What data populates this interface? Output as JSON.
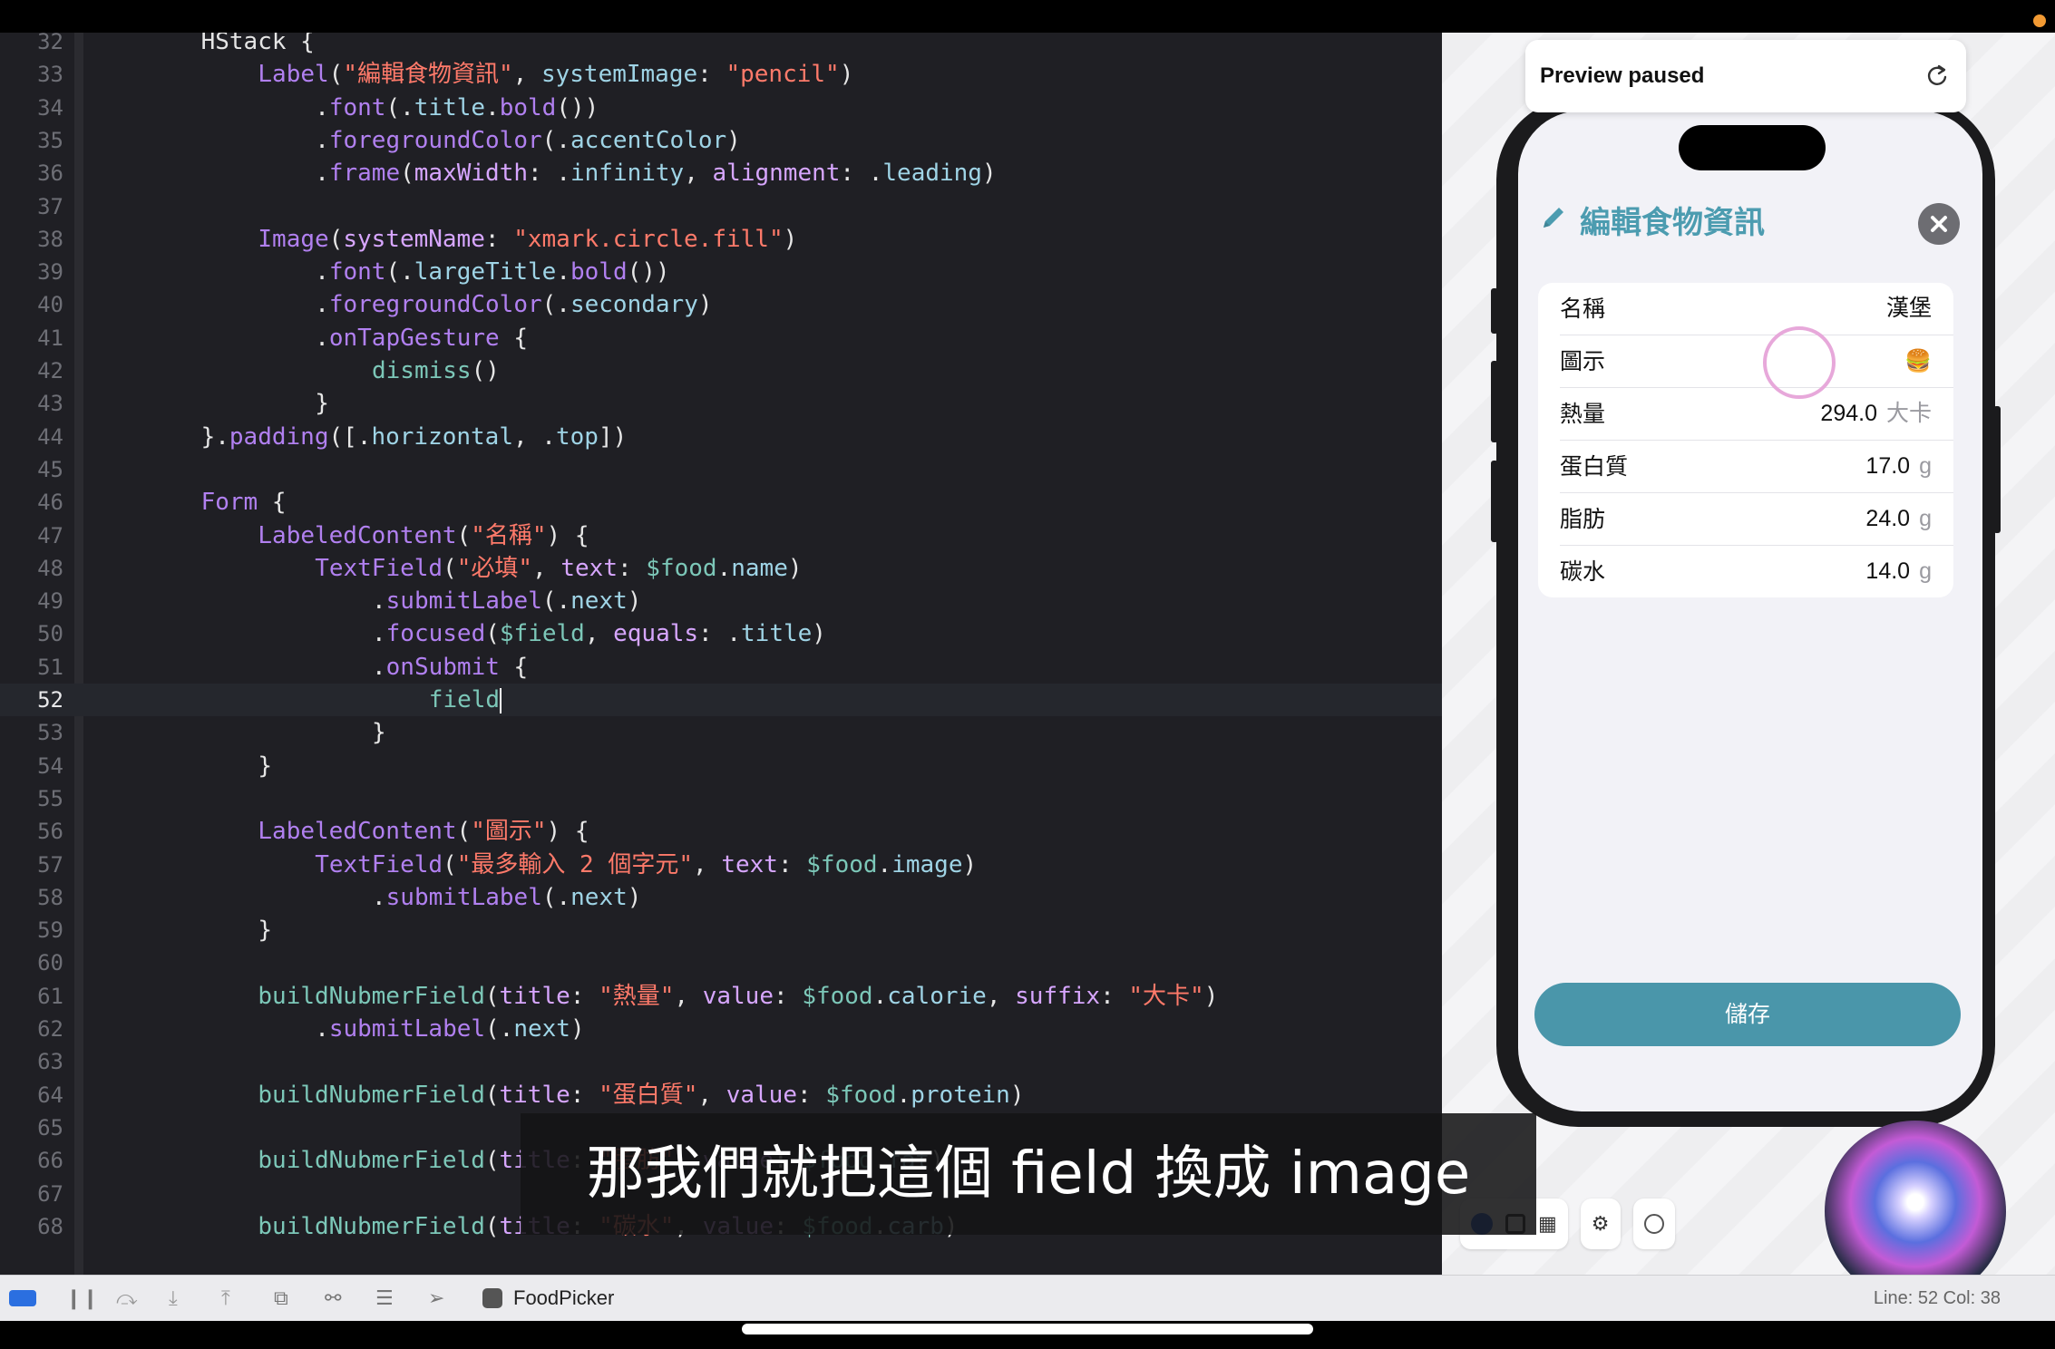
{
  "editor": {
    "lines": [
      {
        "n": "32",
        "code": "<span>HStack {</span>",
        "indent": 8
      },
      {
        "n": "33",
        "code": "<span class='fn'>Label</span>(<span class='str'>\"編輯食物資訊\"</span>, <span class='prop'>systemImage</span>: <span class='str'>\"pencil\"</span>)",
        "indent": 12
      },
      {
        "n": "34",
        "code": ".<span class='fn'>font</span>(.<span class='prop'>title</span>.<span class='fn'>bold</span>())",
        "indent": 16
      },
      {
        "n": "35",
        "code": ".<span class='fn'>foregroundColor</span>(.<span class='prop'>accentColor</span>)",
        "indent": 16
      },
      {
        "n": "36",
        "code": ".<span class='fn'>frame</span>(<span class='kw'>maxWidth</span>: .<span class='prop'>infinity</span>, <span class='kw'>alignment</span>: .<span class='prop'>leading</span>)",
        "indent": 16
      },
      {
        "n": "37",
        "code": "",
        "indent": 0
      },
      {
        "n": "38",
        "code": "<span class='fn'>Image</span>(<span class='kw'>systemName</span>: <span class='str'>\"xmark.circle.fill\"</span>)",
        "indent": 12
      },
      {
        "n": "39",
        "code": ".<span class='fn'>font</span>(.<span class='prop'>largeTitle</span>.<span class='fn'>bold</span>())",
        "indent": 16
      },
      {
        "n": "40",
        "code": ".<span class='fn'>foregroundColor</span>(.<span class='prop'>secondary</span>)",
        "indent": 16
      },
      {
        "n": "41",
        "code": ".<span class='fn'>onTapGesture</span> {",
        "indent": 16
      },
      {
        "n": "42",
        "code": "<span class='var'>dismiss</span>()",
        "indent": 20
      },
      {
        "n": "43",
        "code": "}",
        "indent": 16
      },
      {
        "n": "44",
        "code": "}.<span class='fn'>padding</span>([.<span class='prop'>horizontal</span>, .<span class='prop'>top</span>])",
        "indent": 8
      },
      {
        "n": "45",
        "code": "",
        "indent": 0
      },
      {
        "n": "46",
        "code": "<span class='fn'>Form</span> {",
        "indent": 8
      },
      {
        "n": "47",
        "code": "<span class='fn'>LabeledContent</span>(<span class='str'>\"名稱\"</span>) {",
        "indent": 12
      },
      {
        "n": "48",
        "code": "<span class='fn'>TextField</span>(<span class='str'>\"必填\"</span>, <span class='kw'>text</span>: <span class='var'>$food</span>.<span class='prop'>name</span>)",
        "indent": 16
      },
      {
        "n": "49",
        "code": ".<span class='fn'>submitLabel</span>(.<span class='prop'>next</span>)",
        "indent": 20
      },
      {
        "n": "50",
        "code": ".<span class='fn'>focused</span>(<span class='var'>$field</span>, <span class='kw'>equals</span>: .<span class='prop'>title</span>)",
        "indent": 20
      },
      {
        "n": "51",
        "code": ".<span class='fn'>onSubmit</span> {",
        "indent": 20
      },
      {
        "n": "52",
        "code": "<span class='var'>field</span><span class='cursor'></span>",
        "indent": 24,
        "current": true
      },
      {
        "n": "53",
        "code": "}",
        "indent": 20
      },
      {
        "n": "54",
        "code": "}",
        "indent": 12
      },
      {
        "n": "55",
        "code": "",
        "indent": 0
      },
      {
        "n": "56",
        "code": "<span class='fn'>LabeledContent</span>(<span class='str'>\"圖示\"</span>) {",
        "indent": 12
      },
      {
        "n": "57",
        "code": "<span class='fn'>TextField</span>(<span class='str'>\"最多輸入 2 個字元\"</span>, <span class='kw'>text</span>: <span class='var'>$food</span>.<span class='prop'>image</span>)",
        "indent": 16
      },
      {
        "n": "58",
        "code": ".<span class='fn'>submitLabel</span>(.<span class='prop'>next</span>)",
        "indent": 20
      },
      {
        "n": "59",
        "code": "}",
        "indent": 12
      },
      {
        "n": "60",
        "code": "",
        "indent": 0
      },
      {
        "n": "61",
        "code": "<span class='var'>buildNubmerField</span>(<span class='kw'>title</span>: <span class='str'>\"熱量\"</span>, <span class='kw'>value</span>: <span class='var'>$food</span>.<span class='prop'>calorie</span>, <span class='kw'>suffix</span>: <span class='str'>\"大卡\"</span>)",
        "indent": 12
      },
      {
        "n": "62",
        "code": ".<span class='fn'>submitLabel</span>(.<span class='prop'>next</span>)",
        "indent": 16
      },
      {
        "n": "63",
        "code": "",
        "indent": 0
      },
      {
        "n": "64",
        "code": "<span class='var'>buildNubmerField</span>(<span class='kw'>title</span>: <span class='str'>\"蛋白質\"</span>, <span class='kw'>value</span>: <span class='var'>$food</span>.<span class='prop'>protein</span>)",
        "indent": 12
      },
      {
        "n": "65",
        "code": "",
        "indent": 0
      },
      {
        "n": "66",
        "code": "<span class='var'>buildNubmerField</span>(<span class='kw'>title</span>: <span class='str'>\"脂肪\"</span>, <span class='kw'>value</span>: <span class='var'>$food</span>.<span class='prop'>fat</span>)",
        "indent": 12
      },
      {
        "n": "67",
        "code": "",
        "indent": 0
      },
      {
        "n": "68",
        "code": "<span class='var'>buildNubmerField</span>(<span class='kw'>title</span>: <span class='str'>\"碳水\"</span>, <span class='kw'>value</span>: <span class='var'>$food</span>.<span class='prop'>carb</span>)",
        "indent": 12
      }
    ]
  },
  "preview": {
    "paused_label": "Preview paused",
    "app": {
      "title": "編輯食物資訊",
      "rows": [
        {
          "label": "名稱",
          "value": "漢堡",
          "suffix": ""
        },
        {
          "label": "圖示",
          "value": "🍔",
          "suffix": ""
        },
        {
          "label": "熱量",
          "value": "294.0",
          "suffix": "大卡"
        },
        {
          "label": "蛋白質",
          "value": "17.0",
          "suffix": "g"
        },
        {
          "label": "脂肪",
          "value": "24.0",
          "suffix": "g"
        },
        {
          "label": "碳水",
          "value": "14.0",
          "suffix": "g"
        }
      ],
      "save_label": "儲存"
    }
  },
  "subtitle": "那我們就把這個 field 換成 image",
  "statusbar": {
    "scheme": "FoodPicker",
    "line_col": "Line: 52  Col: 38"
  },
  "colors": {
    "accent": "#4c9cb0",
    "editor_bg": "#1f1f24",
    "string": "#ff7a6a"
  }
}
